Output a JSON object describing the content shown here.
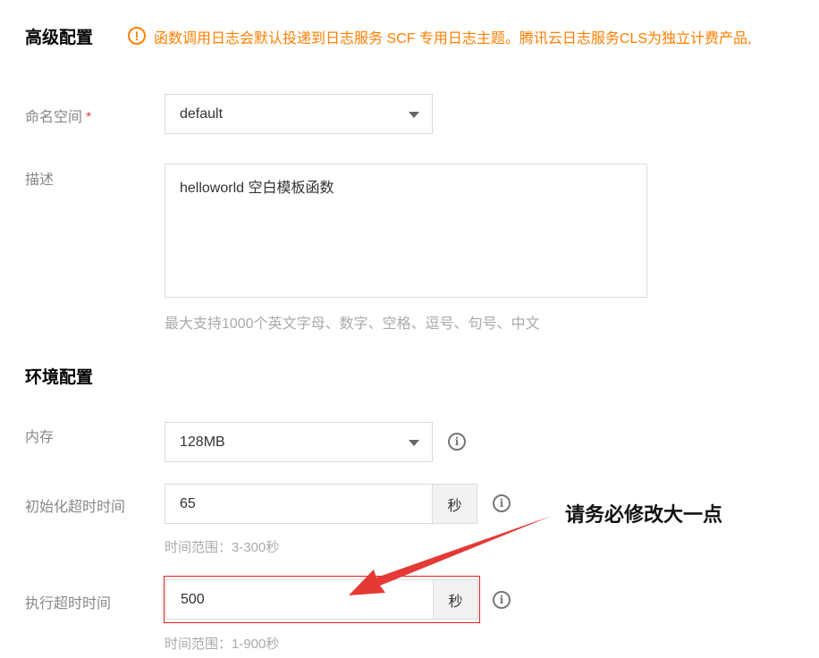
{
  "advanced": {
    "title": "高级配置",
    "warning_icon": "exclamation-circle-icon",
    "warning_text": "函数调用日志会默认投递到日志服务 SCF 专用日志主题。腾讯云日志服务CLS为独立计费产品,",
    "namespace": {
      "label": "命名空间",
      "required_mark": "*",
      "value": "default"
    },
    "description": {
      "label": "描述",
      "value": "helloworld 空白模板函数",
      "hint": "最大支持1000个英文字母、数字、空格、逗号、句号、中文"
    }
  },
  "environment": {
    "title": "环境配置",
    "memory": {
      "label": "内存",
      "value": "128MB",
      "info_icon": "info-icon"
    },
    "init_timeout": {
      "label": "初始化超时时间",
      "value": "65",
      "unit": "秒",
      "hint": "时间范围：3-300秒",
      "info_icon": "info-icon"
    },
    "exec_timeout": {
      "label": "执行超时时间",
      "value": "500",
      "unit": "秒",
      "hint": "时间范围：1-900秒",
      "info_icon": "info-icon"
    }
  },
  "annotation": {
    "text": "请务必修改大一点",
    "highlight_color": "#e02020",
    "arrow_color": "#e53935"
  },
  "colors": {
    "warning": "#ff7f00",
    "label": "#888888",
    "hint": "#aaaaaa",
    "required": "#e54545"
  }
}
